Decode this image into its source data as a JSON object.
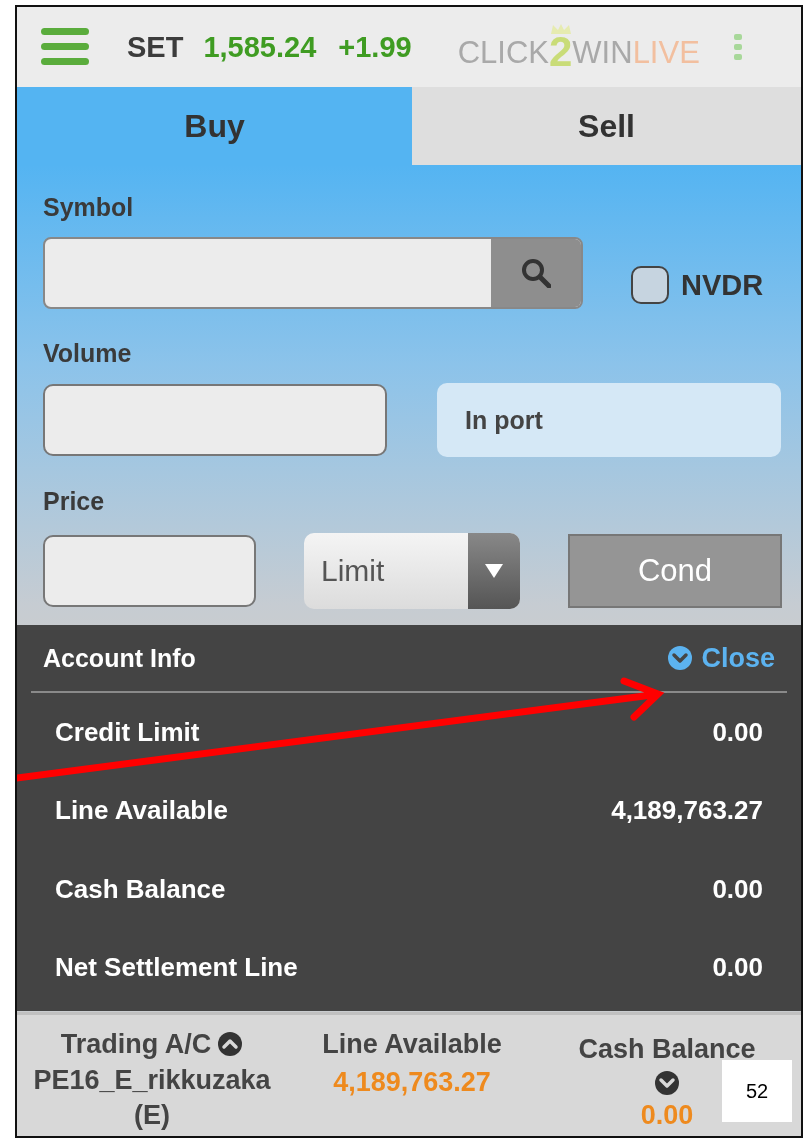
{
  "header": {
    "index_name": "SET",
    "index_value": "1,585.24",
    "index_change": "+1.99",
    "logo": [
      "CLICK",
      "2",
      "WIN",
      "LIVE"
    ]
  },
  "tabs": [
    {
      "label": "Buy",
      "selected": true
    },
    {
      "label": "Sell",
      "selected": false
    }
  ],
  "form": {
    "symbol_label": "Symbol",
    "nvdr": {
      "label": "NVDR",
      "checked": false
    },
    "volume_label": "Volume",
    "in_port": "In port",
    "price_label": "Price",
    "order_type": "Limit",
    "cond_button": "Cond"
  },
  "account_info": {
    "title": "Account Info",
    "close": "Close",
    "rows": [
      {
        "label": "Credit Limit",
        "value": "0.00"
      },
      {
        "label": "Line Available",
        "value": "4,189,763.27"
      },
      {
        "label": "Cash Balance",
        "value": "0.00"
      },
      {
        "label": "Net Settlement Line",
        "value": "0.00"
      }
    ]
  },
  "footer": {
    "trading_ac_label": "Trading A/C",
    "account": "PE16_E_rikkuzaka (E)",
    "line_available_label": "Line Available",
    "line_available": "4,189,763.27",
    "cash_balance_label": "Cash Balance",
    "cash_balance": "0.00"
  },
  "page_number": "52"
}
